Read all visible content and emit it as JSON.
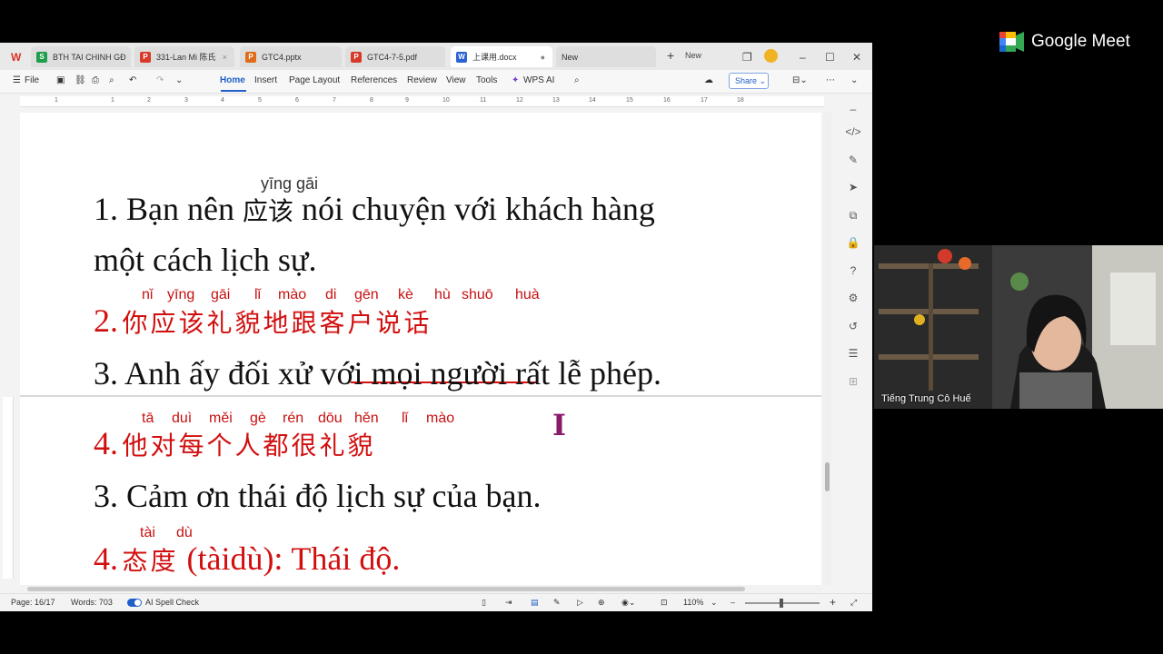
{
  "tabs": [
    {
      "label": "BTH TAI CHINH GĐ",
      "icon": "S",
      "color": "#1e9e4a"
    },
    {
      "label": "331-Lan Mi 陈氏",
      "icon": "P",
      "color": "#d83a2a"
    },
    {
      "label": "GTC4.pptx",
      "icon": "P",
      "color": "#e06b1a"
    },
    {
      "label": "GTC4-7-5.pdf",
      "icon": "P",
      "color": "#d83a2a"
    },
    {
      "label": "上课用.docx",
      "icon": "W",
      "color": "#2a62d4"
    },
    {
      "label": "New",
      "icon": "",
      "color": ""
    }
  ],
  "new_tab_label": "New",
  "ribbon": {
    "file": "File",
    "menus": [
      "Home",
      "Insert",
      "Page Layout",
      "References",
      "Review",
      "View",
      "Tools"
    ],
    "wps_ai": "WPS AI",
    "share": "Share"
  },
  "ruler_numbers": [
    "1",
    "2",
    "1",
    "2",
    "3",
    "4",
    "5",
    "6",
    "7",
    "8",
    "9",
    "10",
    "11",
    "12",
    "13",
    "14",
    "15",
    "16",
    "17",
    "18"
  ],
  "doc": {
    "line1_pinyin": "yīng gāi",
    "line1a_pre": "1. Bạn nên ",
    "line1a_cn": "应该",
    "line1a_post": " nói chuyện với khách hàng",
    "line1b": "một cách lịch sự.",
    "line2_pinyin": [
      "nǐ",
      "yīng",
      "gāi",
      "lǐ",
      "mào",
      "di",
      "gēn",
      "kè",
      "hù",
      "shuō",
      "huà"
    ],
    "line2_num": "2.",
    "line2_cn": "你应该礼貌地跟客户说话",
    "line3": "3. Anh ấy đối xử với mọi người rất lễ phép.",
    "line4_pinyin": [
      "tā",
      "duì",
      "měi",
      "gè",
      "rén",
      "dōu",
      "hěn",
      "lǐ",
      "mào"
    ],
    "line4_num": "4.",
    "line4_cn": "他对每个人都很礼貌",
    "line5": "3. Cảm ơn thái độ lịch sự của bạn.",
    "line6_pinyin": [
      "tài",
      "dù"
    ],
    "line6_num": "4.",
    "line6_cn": "态度",
    "line6_post": " (tàidù): Thái độ."
  },
  "status": {
    "page": "Page: 16/17",
    "words": "Words: 703",
    "spell": "AI Spell Check",
    "zoom": "110%"
  },
  "meet": {
    "title": "Google Meet",
    "participant": "Tiếng Trung Cô Huế"
  },
  "icons": [
    "wps-logo-icon",
    "save-icon",
    "undo-icon",
    "redo-icon",
    "search-icon",
    "cloud-icon",
    "more-icon",
    "minimize-icon",
    "maximize-icon",
    "close-icon",
    "code-icon",
    "pen-icon",
    "cursor-icon",
    "crop-icon",
    "lock-icon",
    "help-icon",
    "settings-icon",
    "history-icon",
    "layers-icon",
    "grid-icon"
  ]
}
